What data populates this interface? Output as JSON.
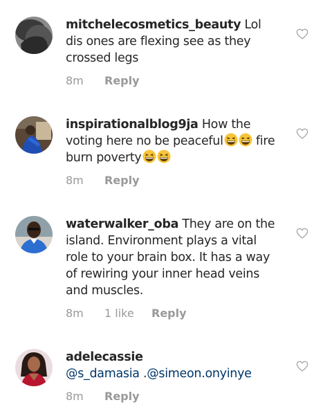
{
  "comments": [
    {
      "username": "mitchelecosmetics_beauty",
      "text": "Lol dis ones are flexing see as they crossed legs",
      "time": "8m",
      "likes": "",
      "reply": "Reply"
    },
    {
      "username": "inspirationalblog9ja",
      "text": "How the voting here no be peaceful",
      "text_after": "fire burn poverty",
      "time": "8m",
      "likes": "",
      "reply": "Reply"
    },
    {
      "username": "waterwalker_oba",
      "text": "They are on the island. Environment plays a vital role to your brain box. It has a way of rewiring your inner head veins and muscles.",
      "time": "8m",
      "likes": "1 like",
      "reply": "Reply"
    },
    {
      "username": "adelecassie",
      "mention_1": "@s_damasia",
      "mention_sep": " .",
      "mention_2": "@simeon.onyinye",
      "time": "8m",
      "likes": "",
      "reply": "Reply"
    }
  ],
  "icons": {
    "like": "heart-outline-icon",
    "emoji": "grinning-squinting-face-emoji"
  },
  "colors": {
    "text": "#262626",
    "muted": "#999999",
    "mention": "#00376b",
    "heart_stroke": "#a8a8a8",
    "emoji_yellow": "#f7c53a"
  }
}
